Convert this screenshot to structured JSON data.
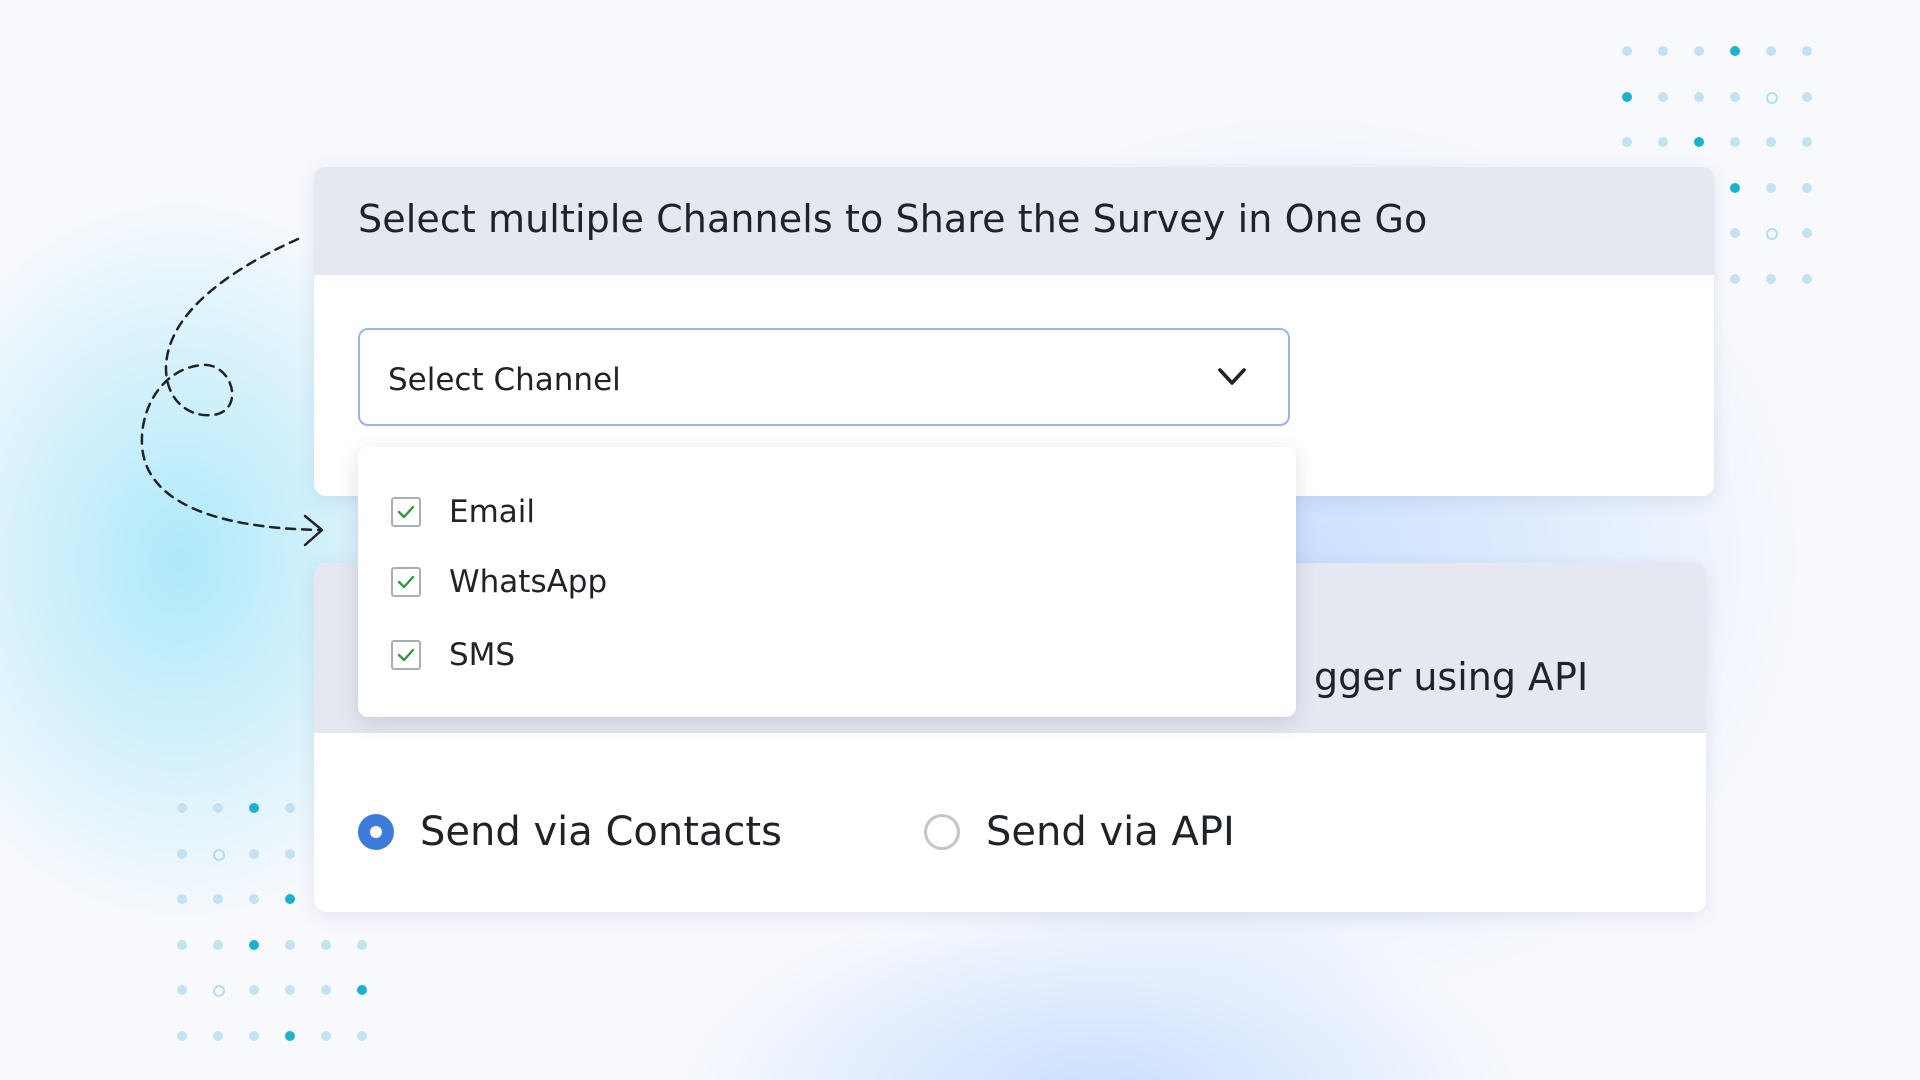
{
  "channel_card": {
    "title": "Select multiple Channels to Share the Survey in One Go",
    "select": {
      "placeholder": "Select Channel",
      "icon": "chevron-down-icon"
    }
  },
  "channel_dropdown": {
    "options": [
      {
        "label": "Email",
        "checked": true
      },
      {
        "label": "WhatsApp",
        "checked": true
      },
      {
        "label": "SMS",
        "checked": true
      }
    ]
  },
  "send_card": {
    "title_visible_fragment": "gger using API",
    "options": [
      {
        "label": "Send via Contacts",
        "selected": true
      },
      {
        "label": "Send via API",
        "selected": false
      }
    ]
  },
  "colors": {
    "accent": "#3d7cdc",
    "check": "#2e9a3a",
    "header_bg": "#e5e8f0",
    "dot_dark": "#1cb1cf",
    "dot_light": "#c3e2f1"
  }
}
